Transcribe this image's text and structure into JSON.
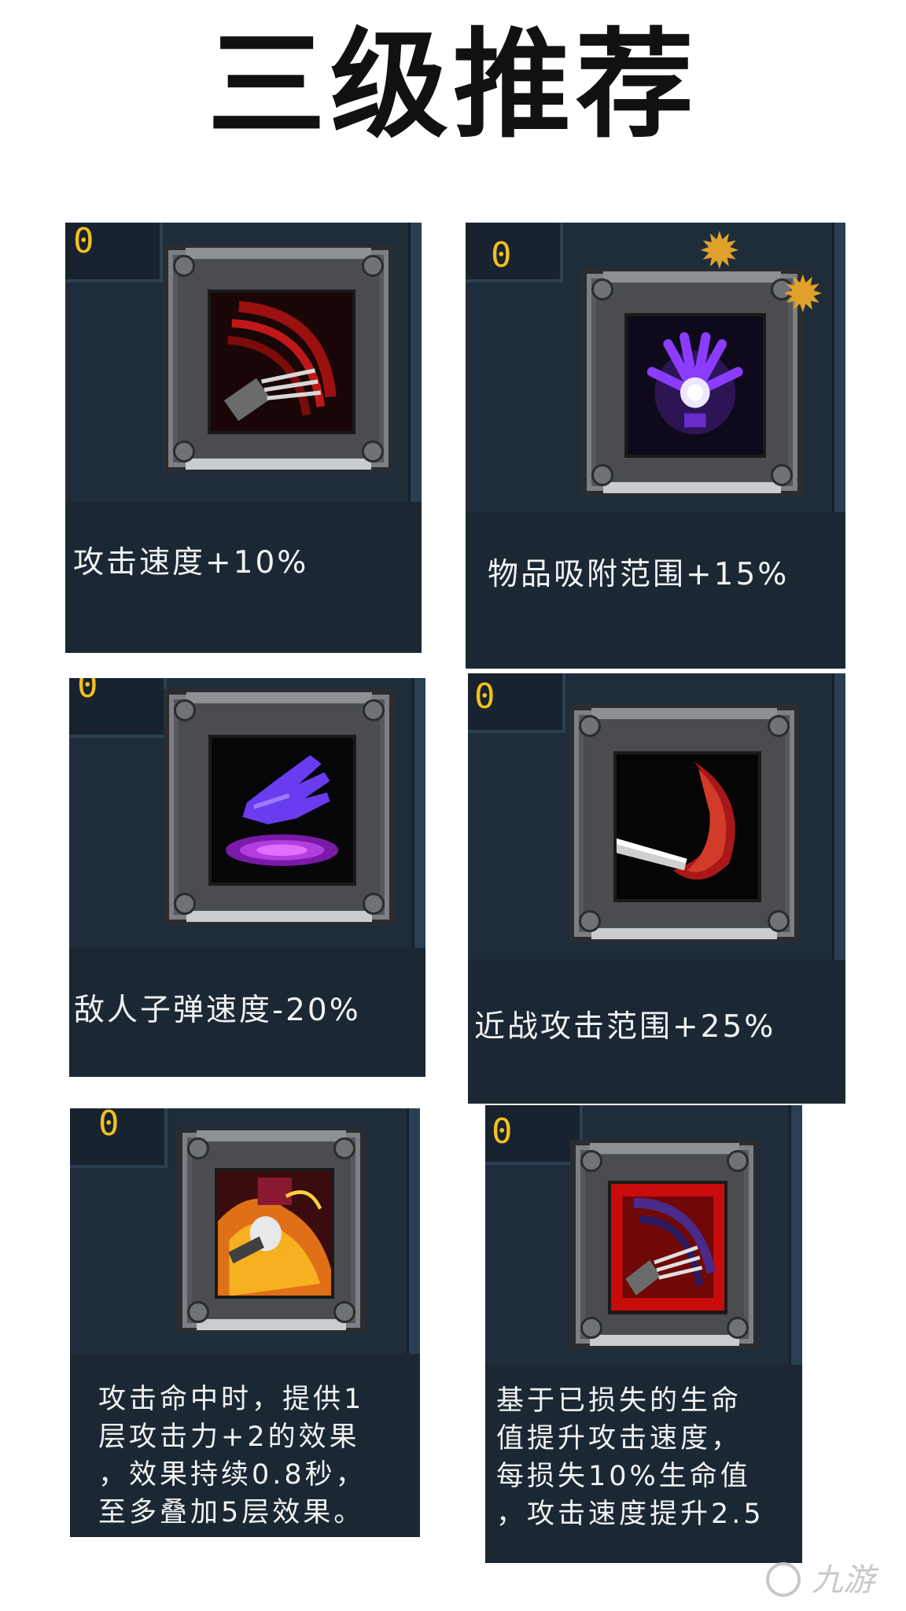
{
  "title": "三级推荐",
  "cards": [
    {
      "level": "0",
      "icon": "claw-slash-icon",
      "desc": "攻击速度+10%"
    },
    {
      "level": "0",
      "icon": "magnet-hand-icon",
      "desc": "物品吸附范围+15%"
    },
    {
      "level": "0",
      "icon": "purple-glove-icon",
      "desc": "敌人子弹速度-20%"
    },
    {
      "level": "0",
      "icon": "blade-arc-icon",
      "desc": "近战攻击范围+25%"
    },
    {
      "level": "0",
      "icon": "flaming-fist-icon",
      "desc": "攻击命中时，提供1\n层攻击力+2的效果\n，效果持续0.8秒，\n至多叠加5层效果。"
    },
    {
      "level": "0",
      "icon": "red-claw-icon",
      "desc": "基于已损失的生命\n值提升攻击速度，\n每损失10%生命值\n，攻击速度提升2.5"
    }
  ],
  "watermark": "九游",
  "colors": {
    "card_bg": "#1f2d3b",
    "level": "#f4c11c",
    "text": "#f2f2f2",
    "gear": "#e0a12b"
  }
}
